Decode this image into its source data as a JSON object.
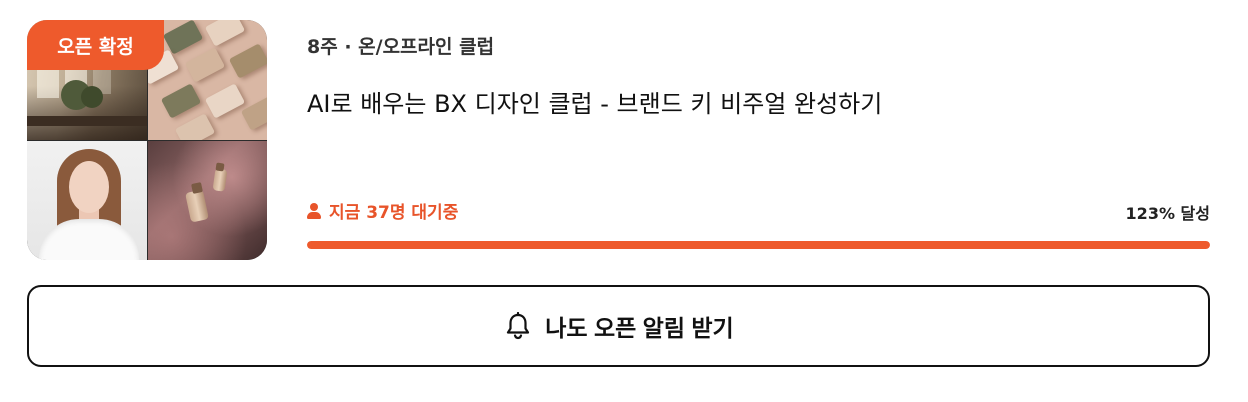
{
  "badge": {
    "label": "오픈 확정"
  },
  "course": {
    "meta": "8주 · 온/오프라인 클럽",
    "title": "AI로 배우는 BX 디자인 클럽 - 브랜드 키 비주얼 완성하기"
  },
  "status": {
    "waiting_text": "지금 37명 대기중",
    "waiting_count": 37,
    "achieved_text": "123% 달성",
    "achieved_percent": 123
  },
  "progress": {
    "fill_fraction": 1.0
  },
  "cta": {
    "label": "나도 오픈 알림 받기",
    "icon": "bell-icon"
  },
  "thumbnail": {
    "tiles": [
      "room-interior-photo",
      "product-packs-photo",
      "instructor-portrait-photo",
      "perfume-bottle-photo"
    ]
  },
  "colors": {
    "accent": "#ee5a2c",
    "text": "#111111",
    "progress_track": "#f0e2dc"
  }
}
